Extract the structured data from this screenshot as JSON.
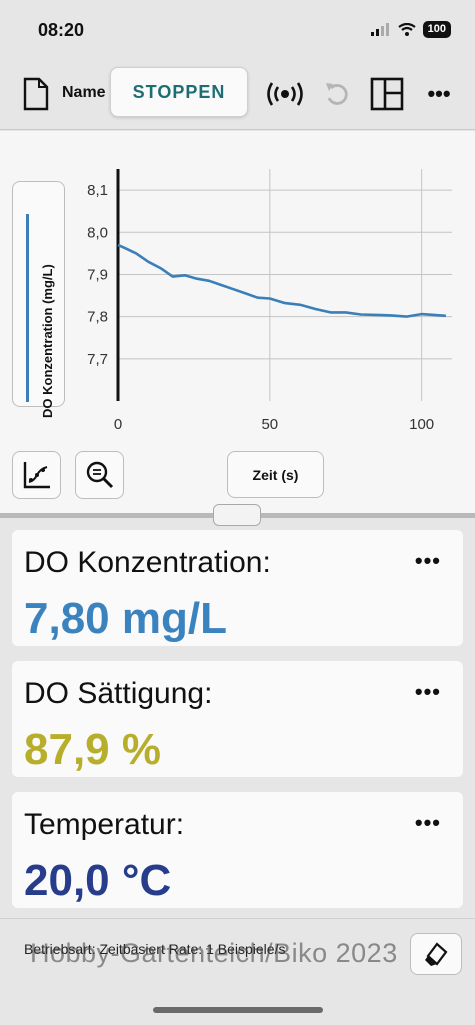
{
  "status_bar": {
    "time": "08:20",
    "battery": "100"
  },
  "toolbar": {
    "name_label": "Name",
    "stop_label": "STOPPEN"
  },
  "graph": {
    "y_axis_label": "DO Konzentration (mg/L)",
    "x_axis_label": "Zeit (s)"
  },
  "chart_data": {
    "type": "line",
    "xlabel": "Zeit (s)",
    "ylabel": "DO Konzentration (mg/L)",
    "xlim": [
      0,
      110
    ],
    "ylim": [
      7.6,
      8.15
    ],
    "x_ticks": [
      "0",
      "50",
      "100"
    ],
    "y_ticks": [
      "8,1",
      "8,0",
      "7,9",
      "7,8",
      "7,7"
    ],
    "grid": true,
    "series": [
      {
        "color": "#3a7fb9",
        "x": [
          0,
          3,
          6,
          10,
          14,
          18,
          22,
          26,
          30,
          34,
          38,
          42,
          46,
          50,
          55,
          60,
          65,
          70,
          75,
          80,
          85,
          90,
          95,
          100,
          104,
          108
        ],
        "y": [
          7.97,
          7.96,
          7.95,
          7.93,
          7.915,
          7.895,
          7.898,
          7.89,
          7.885,
          7.875,
          7.865,
          7.855,
          7.845,
          7.843,
          7.832,
          7.828,
          7.818,
          7.81,
          7.81,
          7.805,
          7.804,
          7.803,
          7.8,
          7.806,
          7.804,
          7.802
        ]
      }
    ]
  },
  "meters": [
    {
      "label": "DO Konzentration:",
      "value": "7,80 mg/L",
      "color": "#3a83bf"
    },
    {
      "label": "DO Sättigung:",
      "value": "87,9 %",
      "color": "#b7ae2b"
    },
    {
      "label": "Temperatur:",
      "value": "20,0 °C",
      "color": "#283c8c"
    }
  ],
  "meter_more_label": "•••",
  "footer": {
    "info": "Betriebsart: Zeitbasiert    Rate: 1 Beispiele/s"
  },
  "watermark": "Hobby-Gartenteich/Biko 2023",
  "icons": [
    "file-icon",
    "sensor-icon",
    "undo-icon",
    "layout-icon",
    "more-icon",
    "curve-fit-icon",
    "zoom-icon",
    "eraser-icon"
  ]
}
